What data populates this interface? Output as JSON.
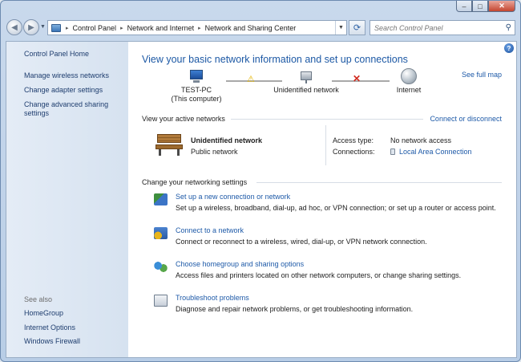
{
  "window": {
    "caption_buttons": [
      "minimize",
      "maximize",
      "close"
    ]
  },
  "navigation": {
    "address": {
      "crumbs": [
        "Control Panel",
        "Network and Internet",
        "Network and Sharing Center"
      ],
      "separator": "▸"
    },
    "search_placeholder": "Search Control Panel"
  },
  "sidebar": {
    "home": "Control Panel Home",
    "items": [
      {
        "label": "Manage wireless networks"
      },
      {
        "label": "Change adapter settings"
      },
      {
        "label": "Change advanced sharing settings"
      }
    ],
    "see_also_label": "See also",
    "see_also": [
      {
        "label": "HomeGroup"
      },
      {
        "label": "Internet Options"
      },
      {
        "label": "Windows Firewall"
      }
    ]
  },
  "main": {
    "title": "View your basic network information and set up connections",
    "see_full_map": "See full map",
    "map": {
      "computer_name": "TEST-PC",
      "computer_sub": "(This computer)",
      "network": "Unidentified network",
      "internet": "Internet"
    },
    "active_header": "View your active networks",
    "connect_disconnect": "Connect or disconnect",
    "active_network": {
      "name": "Unidentified network",
      "type": "Public network",
      "access_type_label": "Access type:",
      "access_type_value": "No network access",
      "connections_label": "Connections:",
      "connections_value": "Local Area Connection"
    },
    "change_header": "Change your networking settings",
    "tasks": [
      {
        "icon": "setup-connection-icon",
        "link": "Set up a new connection or network",
        "desc": "Set up a wireless, broadband, dial-up, ad hoc, or VPN connection; or set up a router or access point."
      },
      {
        "icon": "connect-network-icon",
        "link": "Connect to a network",
        "desc": "Connect or reconnect to a wireless, wired, dial-up, or VPN network connection."
      },
      {
        "icon": "homegroup-icon",
        "link": "Choose homegroup and sharing options",
        "desc": "Access files and printers located on other network computers, or change sharing settings."
      },
      {
        "icon": "troubleshoot-icon",
        "link": "Troubleshoot problems",
        "desc": "Diagnose and repair network problems, or get troubleshooting information."
      }
    ]
  },
  "colors": {
    "link": "#1e5aa8",
    "title": "#1d59a5",
    "sidebar_bg": "#d6e2f0",
    "error": "#d12b1f",
    "warning": "#e4b400"
  }
}
